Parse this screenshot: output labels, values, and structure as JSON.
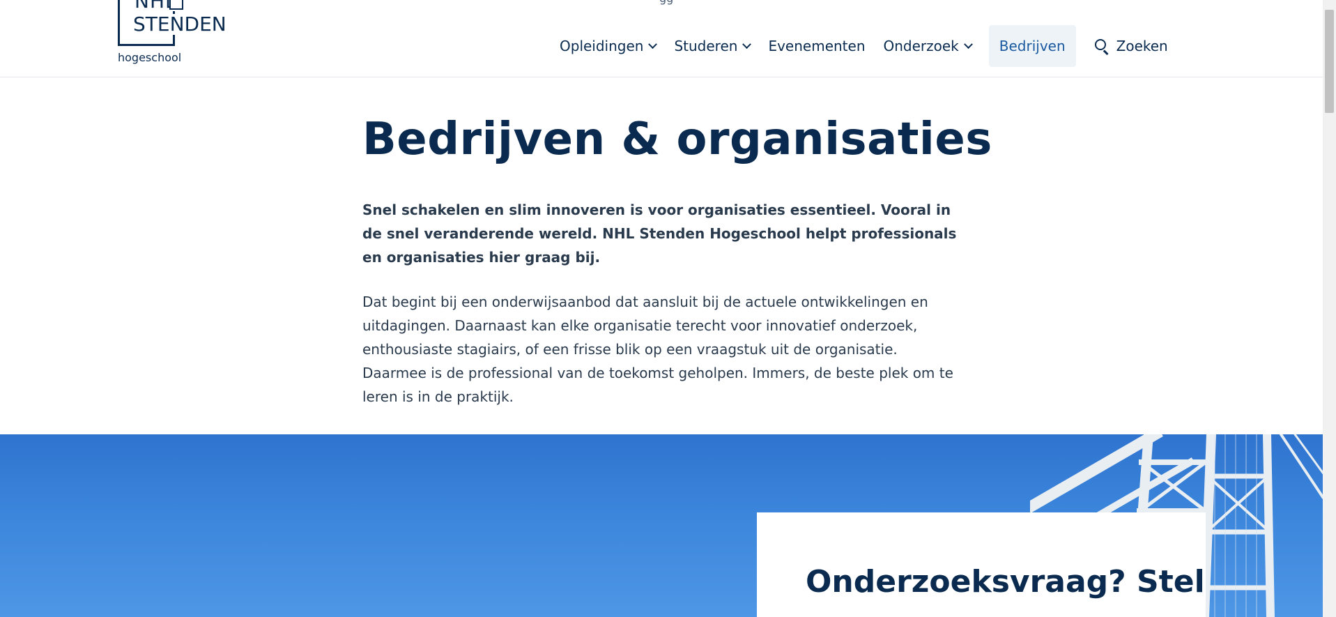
{
  "header": {
    "logo": {
      "line1": "NHL",
      "line2": "STENDEN",
      "line3": "hogeschool"
    },
    "top_partial_text": "gg",
    "nav": {
      "items": [
        {
          "label": "Opleidingen",
          "has_dropdown": true
        },
        {
          "label": "Studeren",
          "has_dropdown": true
        },
        {
          "label": "Evenementen",
          "has_dropdown": false
        },
        {
          "label": "Onderzoek",
          "has_dropdown": true
        },
        {
          "label": "Bedrijven",
          "active": true
        }
      ],
      "search_label": "Zoeken",
      "search_icon": "search-icon"
    }
  },
  "main": {
    "title": "Bedrijven & organisaties",
    "intro": "Snel schakelen en slim innoveren is voor organisaties essentieel. Vooral in de snel veranderende wereld. NHL Stenden Hogeschool helpt professionals en organisaties hier graag bij.",
    "body": "Dat begint bij een onderwijsaanbod dat aansluit bij de actuele ontwikkelingen en uitdagingen. Daarnaast kan elke organisatie terecht voor innovatief onderzoek, enthousiaste stagiairs, of een frisse blik op een vraagstuk uit de organisatie. Daarmee is de professional van de toekomst geholpen. Immers, de beste plek om te leren is in de praktijk."
  },
  "hero": {
    "card_title": "Onderzoeksvraag? Stel"
  },
  "colors": {
    "brand_navy": "#0a2b4f",
    "active_link": "#1a5aa0",
    "active_bg": "#eef3f8",
    "sky": "#3c86dc"
  }
}
